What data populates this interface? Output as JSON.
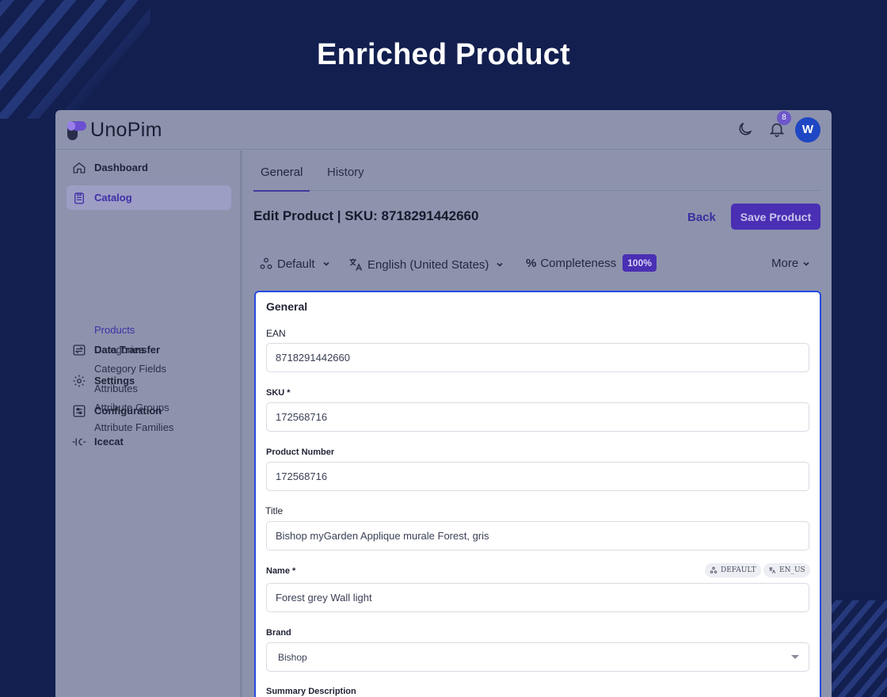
{
  "hero": {
    "title": "Enriched Product"
  },
  "app": {
    "name": "UnoPim",
    "notifications": "8",
    "avatar_initial": "W"
  },
  "sidebar": {
    "items": [
      {
        "label": "Dashboard",
        "icon": "home-icon"
      },
      {
        "label": "Catalog",
        "icon": "clipboard-icon",
        "active": true
      },
      {
        "label": "Data Transfer",
        "icon": "transfer-icon"
      },
      {
        "label": "Settings",
        "icon": "gear-icon"
      },
      {
        "label": "Configuration",
        "icon": "sliders-icon"
      },
      {
        "label": "Icecat",
        "icon": "icecat-icon"
      }
    ],
    "catalog_sub": [
      "Products",
      "Categories",
      "Category Fields",
      "Attributes",
      "Attribute Groups",
      "Attribute Families"
    ]
  },
  "tabs": [
    "General",
    "History"
  ],
  "page": {
    "title": "Edit Product | SKU: 8718291442660",
    "back_label": "Back",
    "save_label": "Save Product"
  },
  "toolbar": {
    "channel": "Default",
    "locale": "English (United States)",
    "completeness_label": "Completeness",
    "completeness_value": "100%",
    "more": "More"
  },
  "form": {
    "section": "General",
    "fields": [
      {
        "label": "EAN",
        "value": "8718291442660"
      },
      {
        "label": "SKU *",
        "value": "172568716"
      },
      {
        "label": "Product Number",
        "value": "172568716"
      },
      {
        "label": "Title",
        "value": "Bishop myGarden Applique murale Forest, gris"
      },
      {
        "label": "Name *",
        "value": "Forest grey Wall light"
      },
      {
        "label": "Brand",
        "value": "Bishop"
      },
      {
        "label": "Summary Description",
        "value": ""
      }
    ],
    "chips": [
      "DEFAULT",
      "EN_US"
    ]
  },
  "colors": {
    "accent": "#4a2fb4",
    "focus_border": "#2a4be0",
    "background": "#121f4f"
  }
}
